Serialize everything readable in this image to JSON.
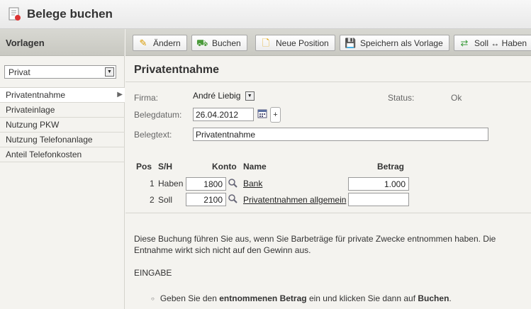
{
  "app": {
    "title": "Belege buchen",
    "icon": "receipt-icon"
  },
  "sidebar": {
    "header": "Vorlagen",
    "template_select": "Privat",
    "items": [
      {
        "label": "Privatentnahme",
        "active": true
      },
      {
        "label": "Privateinlage"
      },
      {
        "label": "Nutzung PKW"
      },
      {
        "label": "Nutzung Telefonanlage"
      },
      {
        "label": "Anteil Telefonkosten"
      }
    ]
  },
  "toolbar": {
    "edit_label": "Ändern",
    "book_label": "Buchen",
    "new_position_label": "Neue Position",
    "save_template_label": "Speichern als Vorlage",
    "swap_label": "Soll ↔ Haben"
  },
  "main": {
    "heading": "Privatentnahme",
    "firma_label": "Firma:",
    "firma_value": "André Liebig",
    "status_label": "Status:",
    "status_value": "Ok",
    "date_label": "Belegdatum:",
    "date_value": "26.04.2012",
    "plus_label": "+",
    "text_label": "Belegtext:",
    "text_value": "Privatentnahme"
  },
  "table": {
    "headers": {
      "pos": "Pos",
      "sh": "S/H",
      "konto": "Konto",
      "name": "Name",
      "betrag": "Betrag"
    },
    "rows": [
      {
        "pos": "1",
        "sh": "Haben",
        "konto": "1800",
        "name": "Bank",
        "betrag": "1.000"
      },
      {
        "pos": "2",
        "sh": "Soll",
        "konto": "2100",
        "name": "Privatentnahmen allgemein",
        "betrag": ""
      }
    ]
  },
  "help": {
    "description": "Diese Buchung führen Sie aus, wenn Sie Barbeträge für private Zwecke entnommen haben. Die Entnahme wirkt sich nicht auf den Gewinn aus.",
    "section": "EINGABE",
    "bullet_pre": "Geben Sie den ",
    "bullet_bold1": "entnommenen Betrag",
    "bullet_mid": " ein und klicken Sie dann auf ",
    "bullet_bold2": "Buchen",
    "bullet_post": "."
  }
}
